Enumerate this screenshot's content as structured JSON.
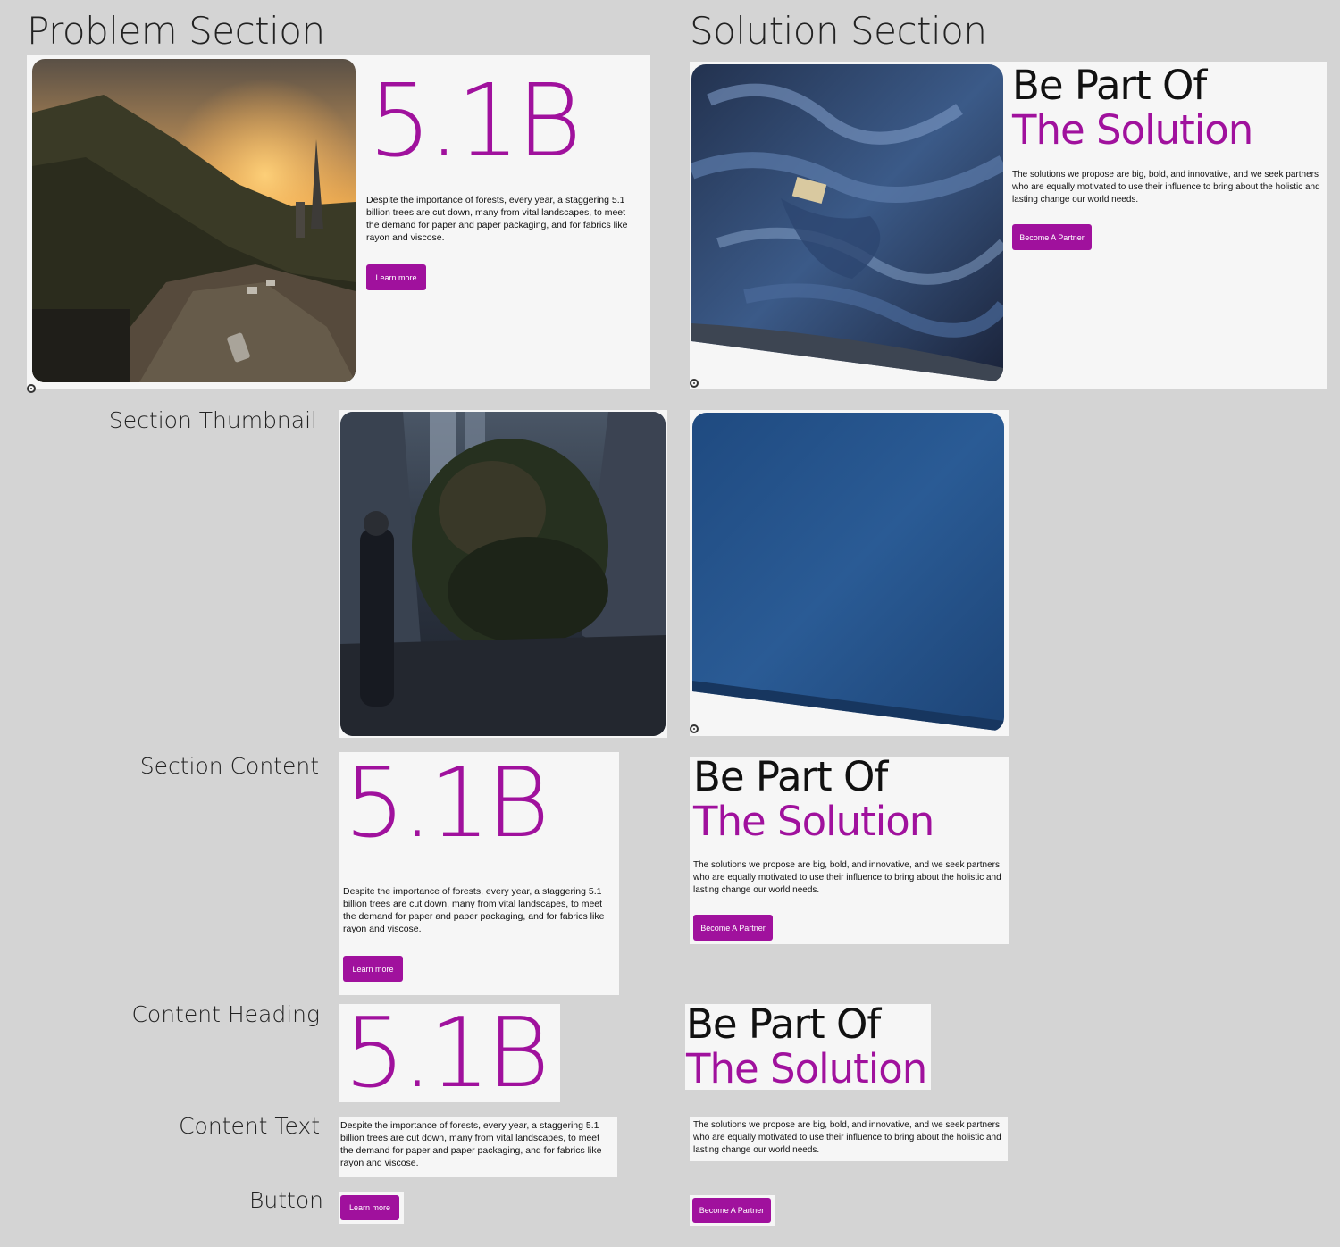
{
  "titles": {
    "problem": "Problem Section",
    "solution": "Solution Section"
  },
  "row_labels": {
    "thumbnail": "Section Thumbnail",
    "content": "Section Content",
    "heading": "Content Heading",
    "text": "Content Text",
    "button": "Button"
  },
  "problem": {
    "stat": "5.1B",
    "text": "Despite the importance of forests, every year, a staggering 5.1 billion trees are cut down, many from vital landscapes, to meet the demand for paper and paper packaging, and for fabrics like rayon and viscose.",
    "button_label": "Learn more"
  },
  "solution": {
    "heading_line1": "Be Part Of",
    "heading_line2": "The Solution",
    "text": "The solutions we propose are big, bold, and innovative, and we seek partners who are equally motivated to use their influence to bring about the holistic and lasting change our world needs.",
    "button_label": "Become A Partner"
  },
  "colors": {
    "accent": "#a0119d",
    "background": "#d4d4d4",
    "panel": "#f6f6f6"
  },
  "icons": [
    "sunset-city-photo",
    "denim-pile-photo",
    "forest-street-photo",
    "blue-fabric-photo",
    "record-icon"
  ]
}
